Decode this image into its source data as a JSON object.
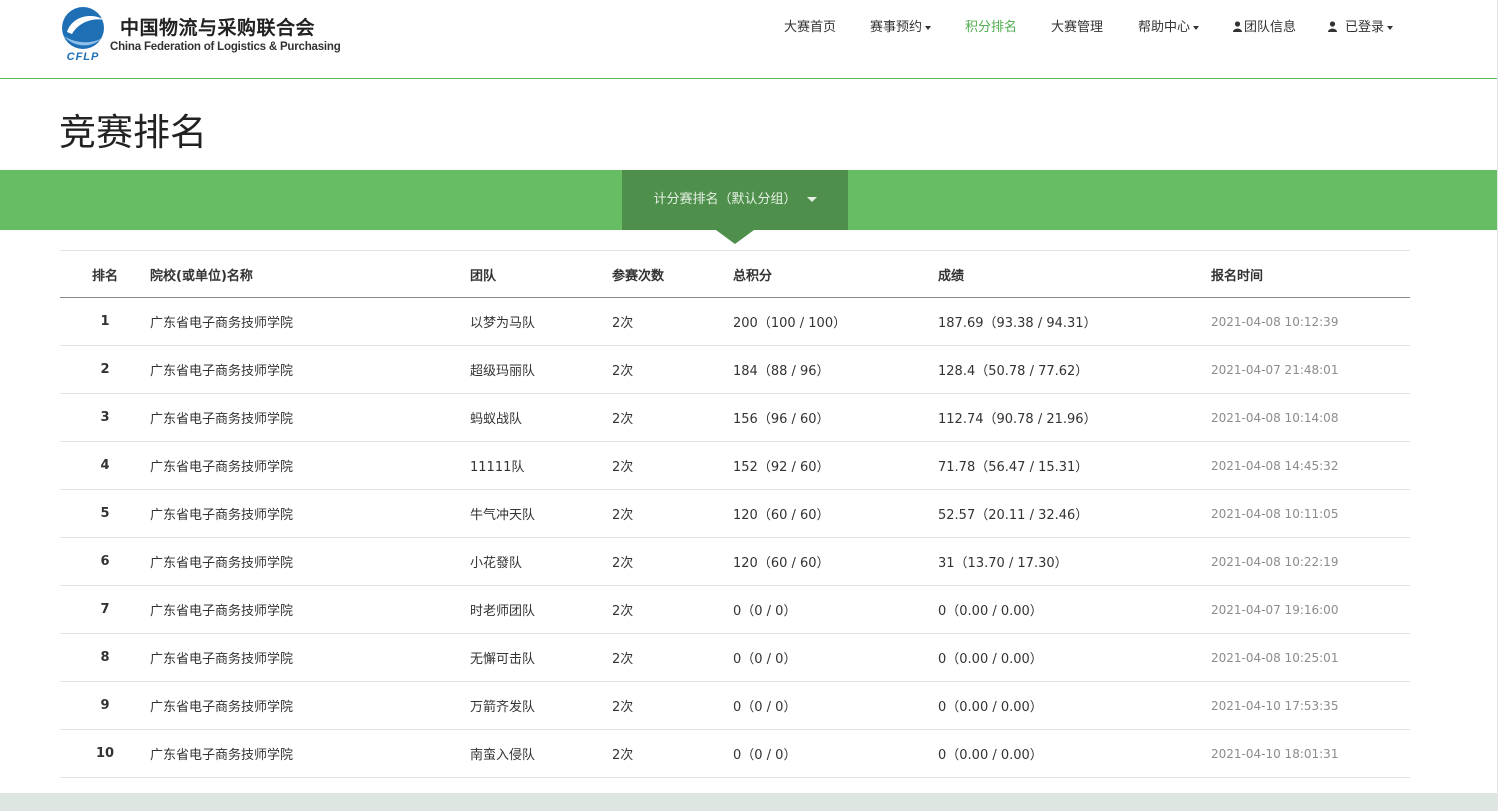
{
  "colors": {
    "accent": "#66bd63",
    "accent_dark": "#4e8f4b",
    "active_nav": "#4fae4f",
    "logo_blue": "#1f6fb5",
    "footer": "#dde6e1"
  },
  "header": {
    "logo": {
      "mark_text": "CFLP",
      "name_cn": "中国物流与采购联合会",
      "name_en": "China Federation of Logistics & Purchasing"
    },
    "nav": [
      {
        "label": "大赛首页",
        "icon": "",
        "dropdown": false,
        "active": false
      },
      {
        "label": "赛事预约",
        "icon": "",
        "dropdown": true,
        "active": false
      },
      {
        "label": "积分排名",
        "icon": "",
        "dropdown": false,
        "active": true
      },
      {
        "label": "大赛管理",
        "icon": "",
        "dropdown": false,
        "active": false
      },
      {
        "label": "帮助中心",
        "icon": "",
        "dropdown": true,
        "active": false
      },
      {
        "label": "团队信息",
        "icon": "user-icon",
        "dropdown": false,
        "active": false
      },
      {
        "label": "已登录",
        "icon": "user-icon",
        "dropdown": true,
        "active": false
      }
    ]
  },
  "page": {
    "title": "竞赛排名",
    "group_selector": "计分赛排名（默认分组）"
  },
  "table": {
    "columns": [
      "排名",
      "院校(或单位)名称",
      "团队",
      "参赛次数",
      "总积分",
      "成绩",
      "报名时间"
    ],
    "rows": [
      [
        "1",
        "广东省电子商务技师学院",
        "以梦为马队",
        "2次",
        "200（100 / 100）",
        "187.69（93.38 / 94.31）",
        "2021-04-08 10:12:39"
      ],
      [
        "2",
        "广东省电子商务技师学院",
        "超级玛丽队",
        "2次",
        "184（88 / 96）",
        "128.4（50.78 / 77.62）",
        "2021-04-07 21:48:01"
      ],
      [
        "3",
        "广东省电子商务技师学院",
        "蚂蚁战队",
        "2次",
        "156（96 / 60）",
        "112.74（90.78 / 21.96）",
        "2021-04-08 10:14:08"
      ],
      [
        "4",
        "广东省电子商务技师学院",
        "11111队",
        "2次",
        "152（92 / 60）",
        "71.78（56.47 / 15.31）",
        "2021-04-08 14:45:32"
      ],
      [
        "5",
        "广东省电子商务技师学院",
        "牛气冲天队",
        "2次",
        "120（60 / 60）",
        "52.57（20.11 / 32.46）",
        "2021-04-08 10:11:05"
      ],
      [
        "6",
        "广东省电子商务技师学院",
        "小花發队",
        "2次",
        "120（60 / 60）",
        "31（13.70 / 17.30）",
        "2021-04-08 10:22:19"
      ],
      [
        "7",
        "广东省电子商务技师学院",
        "时老师团队",
        "2次",
        "0（0 / 0）",
        "0（0.00 / 0.00）",
        "2021-04-07 19:16:00"
      ],
      [
        "8",
        "广东省电子商务技师学院",
        "无懈可击队",
        "2次",
        "0（0 / 0）",
        "0（0.00 / 0.00）",
        "2021-04-08 10:25:01"
      ],
      [
        "9",
        "广东省电子商务技师学院",
        "万箭齐发队",
        "2次",
        "0（0 / 0）",
        "0（0.00 / 0.00）",
        "2021-04-10 17:53:35"
      ],
      [
        "10",
        "广东省电子商务技师学院",
        "南蛮入侵队",
        "2次",
        "0（0 / 0）",
        "0（0.00 / 0.00）",
        "2021-04-10 18:01:31"
      ]
    ]
  }
}
